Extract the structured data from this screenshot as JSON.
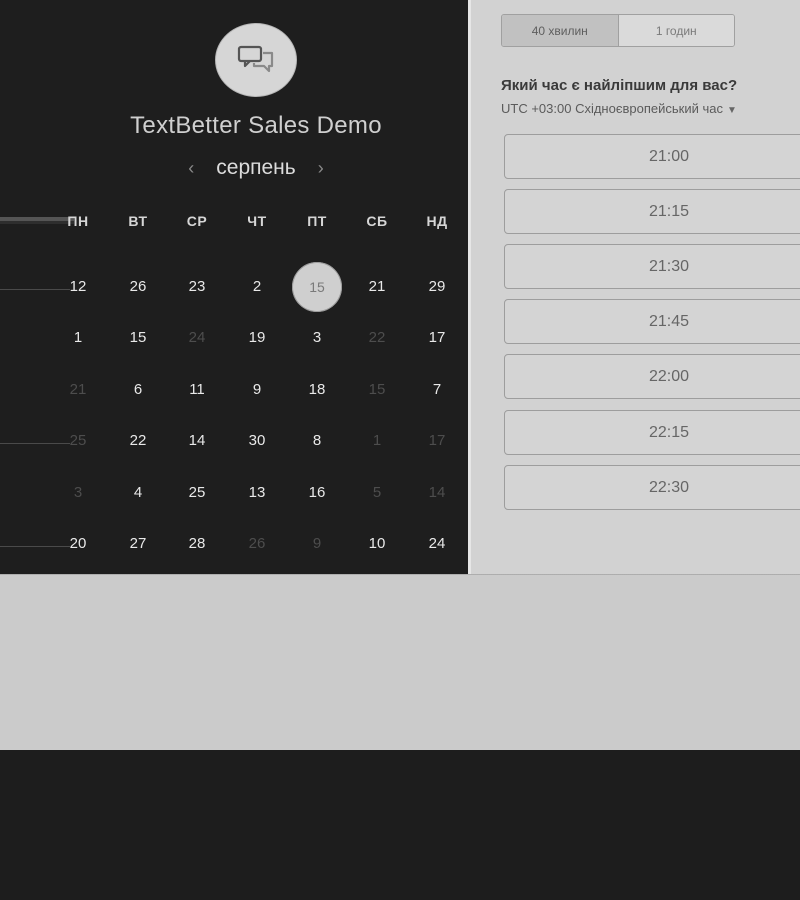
{
  "header": {
    "title": "TextBetter Sales Demo",
    "avatar_icon": "chat-bubbles-icon"
  },
  "calendar": {
    "month": "серпень",
    "prev_icon": "chevron-left-icon",
    "next_icon": "chevron-right-icon",
    "weekdays": [
      "ПН",
      "ВТ",
      "СР",
      "ЧТ",
      "ПТ",
      "СБ",
      "НД"
    ],
    "weeks": [
      [
        {
          "d": "12",
          "m": false
        },
        {
          "d": "26",
          "m": false
        },
        {
          "d": "23",
          "m": false
        },
        {
          "d": "2",
          "m": false
        },
        {
          "d": "15",
          "m": false,
          "s": true
        },
        {
          "d": "21",
          "m": false
        },
        {
          "d": "29",
          "m": false
        }
      ],
      [
        {
          "d": "1",
          "m": false
        },
        {
          "d": "15",
          "m": false
        },
        {
          "d": "24",
          "m": true
        },
        {
          "d": "19",
          "m": false
        },
        {
          "d": "3",
          "m": false
        },
        {
          "d": "22",
          "m": true
        },
        {
          "d": "17",
          "m": false
        }
      ],
      [
        {
          "d": "21",
          "m": true
        },
        {
          "d": "6",
          "m": false
        },
        {
          "d": "11",
          "m": false
        },
        {
          "d": "9",
          "m": false
        },
        {
          "d": "18",
          "m": false
        },
        {
          "d": "15",
          "m": true
        },
        {
          "d": "7",
          "m": false
        }
      ],
      [
        {
          "d": "25",
          "m": true
        },
        {
          "d": "22",
          "m": false
        },
        {
          "d": "14",
          "m": false
        },
        {
          "d": "30",
          "m": false
        },
        {
          "d": "8",
          "m": false
        },
        {
          "d": "1",
          "m": true
        },
        {
          "d": "17",
          "m": true
        }
      ],
      [
        {
          "d": "3",
          "m": true
        },
        {
          "d": "4",
          "m": false
        },
        {
          "d": "25",
          "m": false
        },
        {
          "d": "13",
          "m": false
        },
        {
          "d": "16",
          "m": false
        },
        {
          "d": "5",
          "m": true
        },
        {
          "d": "14",
          "m": true
        }
      ],
      [
        {
          "d": "20",
          "m": false
        },
        {
          "d": "27",
          "m": false
        },
        {
          "d": "28",
          "m": false
        },
        {
          "d": "26",
          "m": true
        },
        {
          "d": "9",
          "m": true
        },
        {
          "d": "10",
          "m": false
        },
        {
          "d": "24",
          "m": false
        }
      ]
    ]
  },
  "duration": {
    "options": [
      "40 хвилин",
      "1 годин"
    ],
    "selected": "40 хвилин"
  },
  "time_picker": {
    "question": "Який час є найліпшим для вас?",
    "timezone": "UTC +03:00 Східноєвропейський час",
    "timezone_icon": "caret-down-icon",
    "slots": [
      "21:00",
      "21:15",
      "21:30",
      "21:45",
      "22:00",
      "22:15",
      "22:30"
    ]
  },
  "colors": {
    "dark_bg": "#1e1e1e",
    "panel_bg": "#d2d2d2",
    "selected_day": "#cfcfcf"
  }
}
